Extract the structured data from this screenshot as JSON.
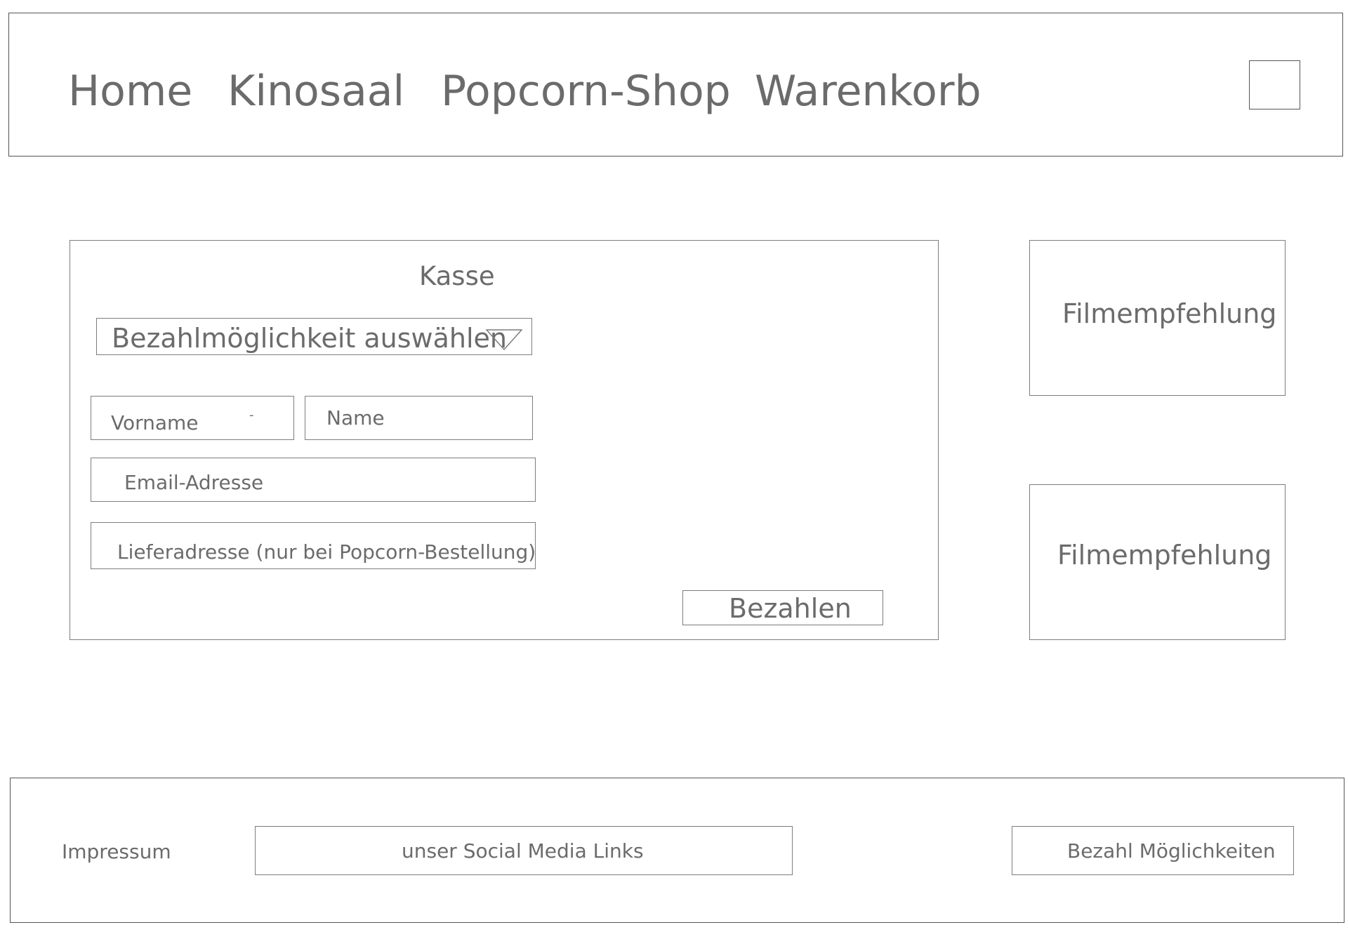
{
  "nav": {
    "items": [
      "Home",
      "Kinosaal",
      "Popcorn-Shop",
      "Warenkorb"
    ]
  },
  "checkout": {
    "title": "Kasse",
    "payment_select": "Bezahlmöglichkeit auswählen",
    "fields": {
      "vorname": "Vorname",
      "vorname_extra": "-",
      "name": "Name",
      "email": "Email-Adresse",
      "address": "Lieferadresse (nur bei Popcorn-Bestellung)"
    },
    "pay_button": "Bezahlen"
  },
  "recommendations": [
    "Filmempfehlung",
    "Filmempfehlung"
  ],
  "footer": {
    "impressum": "Impressum",
    "social": "unser Social Media Links",
    "payment": "Bezahl Möglichkeiten"
  },
  "icons": {
    "header_icon": "placeholder-square-icon",
    "dropdown_icon": "chevron-down-icon"
  },
  "colors": {
    "border": "#7d7d7d",
    "text": "#6b6b6b",
    "background": "#ffffff"
  }
}
